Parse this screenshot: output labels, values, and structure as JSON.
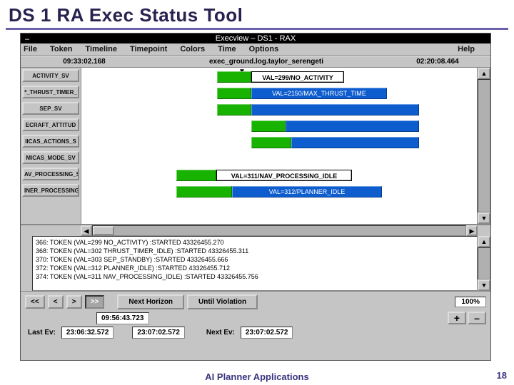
{
  "slide": {
    "title": "DS 1 RA Exec Status Tool",
    "footer": "AI Planner Applications",
    "page": "18"
  },
  "window": {
    "title": "Execview – DS1 - RAX"
  },
  "menu": {
    "file": "File",
    "token": "Token",
    "timeline": "Timeline",
    "timepoint": "Timepoint",
    "colors": "Colors",
    "time": "Time",
    "options": "Options",
    "help": "Help"
  },
  "status": {
    "left_time": "09:33:02.168",
    "center": "exec_ground.log.taylor_serengeti",
    "right_time": "02:20:08.464"
  },
  "rows": {
    "r0": "ACTIVITY_SV",
    "r1": "*_THRUST_TIMER_",
    "r2": "SEP_SV",
    "r3": "ECRAFT_ATTITUD",
    "r4": "IICAS_ACTIONS_S",
    "r5": "MICAS_MODE_SV",
    "r6": "AV_PROCESSING_S",
    "r7": "INER_PROCESSING"
  },
  "tokens": {
    "t1": "VAL=299/NO_ACTIVITY",
    "t2": "VAL=2150/MAX_THRUST_TIME",
    "t3": "VAL=311/NAV_PROCESSING_IDLE",
    "t4": "VAL=312/PLANNER_IDLE"
  },
  "log": {
    "l0": "366: TOKEN (VAL=299 NO_ACTIVITY) :STARTED 43326455.270",
    "l1": "368: TOKEN (VAL=302 THRUST_TIMER_IDLE) :STARTED 43326455.311",
    "l2": "370: TOKEN (VAL=303 SEP_STANDBY) :STARTED 43326455.666",
    "l3": "372: TOKEN (VAL=312 PLANNER_IDLE) :STARTED 43326455.712",
    "l4": "374: TOKEN (VAL=311 NAV_PROCESSING_IDLE) :STARTED 43326455.756"
  },
  "controls": {
    "rew": "<<",
    "prev": "<",
    "next": ">",
    "fwd": ">>",
    "next_horizon": "Next Horizon",
    "until_violation": "Until Violation",
    "zoom": "100%",
    "plus": "+",
    "minus": "–",
    "clock": "09:56:43.723",
    "last_ev_label": "Last Ev:",
    "last_ev": "23:06:32.572",
    "mid_time": "23:07:02.572",
    "next_ev_label": "Next Ev:",
    "next_ev": "23:07:02.572"
  }
}
